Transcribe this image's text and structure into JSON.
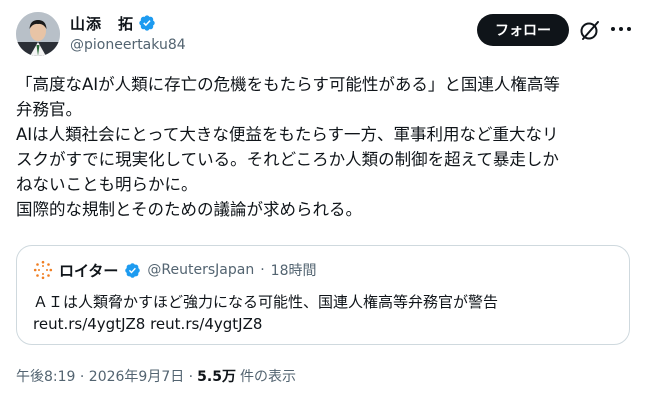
{
  "author": {
    "name": "山添　拓",
    "handle": "@pioneertaku84"
  },
  "actions": {
    "follow_label": "フォロー"
  },
  "tweet": {
    "lines": [
      "「高度なAIが人類に存亡の危機をもたらす可能性がある」と国連人権高等",
      "弁務官。",
      "AIは人類社会にとって大きな便益をもたらす一方、軍事利用など重大なリ",
      "スクがすでに現実化している。それどころか人類の制御を超えて暴走しか",
      "ねないことも明らかに。",
      "国際的な規制とそのための議論が求められる。"
    ]
  },
  "quote": {
    "name": "ロイター",
    "handle": "@ReutersJapan",
    "separator": "·",
    "time": "18時間",
    "text": "ＡＩは人類脅かすほど強力になる可能性、国連人権高等弁務官が警告",
    "links": "reut.rs/4ygtJZ8 reut.rs/4ygtJZ8"
  },
  "footer": {
    "timestamp": "午後8:19 · 2026年9月7日 ·",
    "views_count": "5.5万",
    "views_label": "件の表示"
  },
  "colors": {
    "verified_blue": "#1d9bf0",
    "text_primary": "#0f1419",
    "text_secondary": "#536471",
    "border": "#cfd9de",
    "reuters_orange": "#f07e22"
  },
  "icons": {
    "verified": "verified-badge-icon",
    "grok": "grok-icon",
    "more": "more-dots-icon",
    "reuters_logo": "reuters-logo-icon"
  }
}
